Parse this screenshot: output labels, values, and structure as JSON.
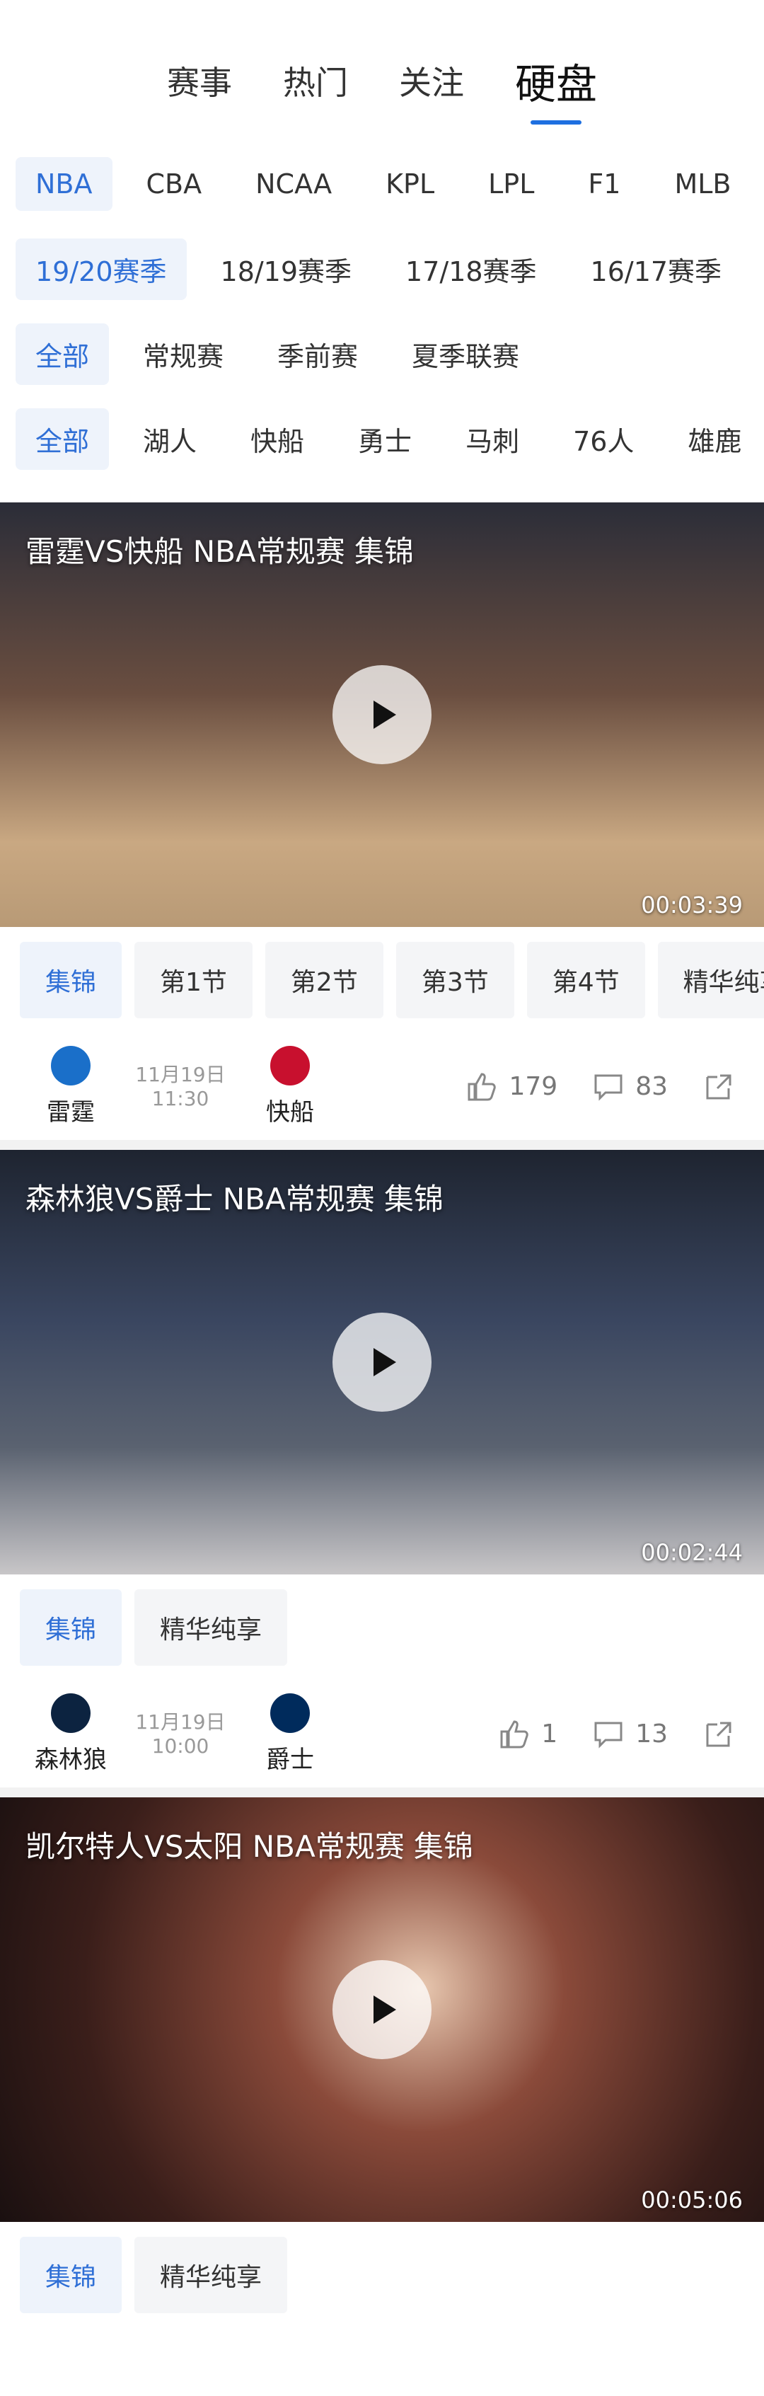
{
  "top_tabs": [
    "赛事",
    "热门",
    "关注",
    "硬盘"
  ],
  "filters": {
    "leagues": [
      "NBA",
      "CBA",
      "NCAA",
      "KPL",
      "LPL",
      "F1",
      "MLB"
    ],
    "seasons": [
      "19/20赛季",
      "18/19赛季",
      "17/18赛季",
      "16/17赛季"
    ],
    "types": [
      "全部",
      "常规赛",
      "季前赛",
      "夏季联赛"
    ],
    "teams": [
      "全部",
      "湖人",
      "快船",
      "勇士",
      "马刺",
      "76人",
      "雄鹿"
    ]
  },
  "videos": [
    {
      "title": "雷霆VS快船 NBA常规赛 集锦",
      "duration": "00:03:39",
      "segments": [
        "集锦",
        "第1节",
        "第2节",
        "第3节",
        "第4节",
        "精华纯享"
      ],
      "home_team": "雷霆",
      "home_logo": "OKC",
      "away_team": "快船",
      "away_logo": "CLIPPERS",
      "date": "11月19日",
      "time": "11:30",
      "likes": "179",
      "comments": "83",
      "bg": "#8a6c58"
    },
    {
      "title": "森林狼VS爵士 NBA常规赛 集锦",
      "duration": "00:02:44",
      "segments": [
        "集锦",
        "精华纯享"
      ],
      "home_team": "森林狼",
      "home_logo": "MIN",
      "away_team": "爵士",
      "away_logo": "UTA",
      "date": "11月19日",
      "time": "10:00",
      "likes": "1",
      "comments": "13",
      "bg": "#3a4458"
    },
    {
      "title": "凯尔特人VS太阳 NBA常规赛 集锦",
      "duration": "00:05:06",
      "segments": [
        "集锦",
        "精华纯享"
      ],
      "bg": "#5a3028"
    }
  ]
}
